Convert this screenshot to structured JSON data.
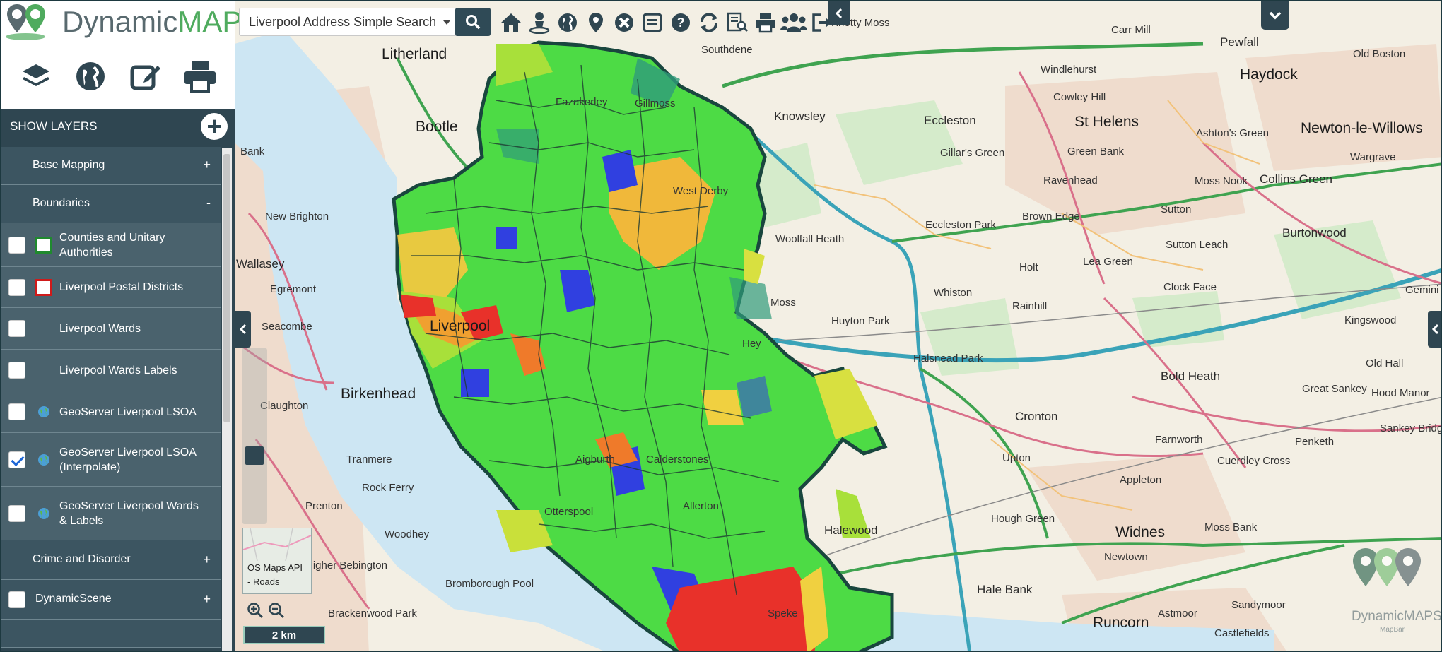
{
  "app": {
    "logo": {
      "part1": "Dynamic",
      "part2": "MAPS"
    },
    "accent_colors": {
      "panel": "#2f4651",
      "logo_green": "#4fab5e",
      "logo_grey": "#596a6f"
    }
  },
  "toolbar_main": {
    "icons": [
      "layers-icon",
      "globe-icon",
      "edit-icon",
      "print-icon"
    ]
  },
  "search": {
    "selected": "Liverpool Address Simple Search",
    "button_icon": "search-icon"
  },
  "top_icons": [
    "home-icon",
    "user-location-icon",
    "globe-icon",
    "map-pin-icon",
    "close-circle-icon",
    "window-icon",
    "help-icon",
    "refresh-icon",
    "report-icon",
    "print-icon",
    "users-icon",
    "sign-out-icon"
  ],
  "layers_panel": {
    "header": "SHOW LAYERS",
    "add_icon": "plus-circle-icon",
    "items": [
      {
        "type": "group",
        "label": "Base Mapping",
        "toggle": "+"
      },
      {
        "type": "group",
        "label": "Boundaries",
        "toggle": "-"
      },
      {
        "type": "layer",
        "label": "Counties and Unitary Authorities",
        "checked": false,
        "swatch": "#1f8a2e"
      },
      {
        "type": "layer",
        "label": "Liverpool Postal Districts",
        "checked": false,
        "swatch": "#d01a1a"
      },
      {
        "type": "layer",
        "label": "Liverpool Wards",
        "checked": false
      },
      {
        "type": "layer",
        "label": "Liverpool Wards Labels",
        "checked": false
      },
      {
        "type": "layer",
        "label": "GeoServer Liverpool LSOA",
        "checked": false,
        "icon": "globe-icon"
      },
      {
        "type": "layer",
        "label": "GeoServer Liverpool LSOA (Interpolate)",
        "checked": true,
        "icon": "globe-icon"
      },
      {
        "type": "layer",
        "label": "GeoServer Liverpool Wards & Labels",
        "checked": false,
        "icon": "globe-icon"
      },
      {
        "type": "group",
        "label": "Crime and Disorder",
        "toggle": "+"
      },
      {
        "type": "group",
        "label": "DynamicScene",
        "toggle": "+",
        "checkbox": true
      }
    ]
  },
  "map": {
    "places": [
      "Litherland",
      "Bootle",
      "Knowsley",
      "Southdene",
      "Carr Mill",
      "Pewfall",
      "Haydock",
      "Windlehurst",
      "Cowley Hill",
      "Old Boston",
      "Newton-le-Willows",
      "Ashton's Green",
      "Eccleston",
      "St Helens",
      "Gillar's Green",
      "Green Bank",
      "Moss Nook",
      "Collins Green",
      "Wargrave",
      "Ravenhead",
      "Brown Edge",
      "Sutton",
      "Burtonwood",
      "Woolfall Heath",
      "Eccleston Park",
      "Lea Green",
      "Sutton Leach",
      "Holt",
      "Whiston",
      "Clock Face",
      "Rainhill",
      "Gemini",
      "Huyton Park",
      "Kingswood",
      "Old Hall",
      "Halsnead Park",
      "Bold Heath",
      "Great Sankey",
      "Hood Manor",
      "Sankey Bridges",
      "Penketh",
      "Cronton",
      "Farnworth",
      "Cuerdley Cross",
      "Upton",
      "Appleton",
      "Hough Green",
      "Widnes",
      "Moss Bank",
      "Halewood",
      "Newtown",
      "Hale Bank",
      "Astmoor",
      "Sandymoor",
      "Runcorn",
      "Castlefields",
      "New Brighton",
      "Wallasey",
      "Egremont",
      "Seacombe",
      "Birkenhead",
      "Claughton",
      "Tranmere",
      "Rock Ferry",
      "Prenton",
      "Woodhey",
      "Higher Bebington",
      "Bromborough Pool",
      "Brackenwood Park",
      "Bank",
      "Liverpool",
      "Moss",
      "Knotty Moss",
      "Hey",
      "Fazakerley",
      "Gillmoss",
      "West Derby",
      "Allerton",
      "Aigburth",
      "Calderstones",
      "Otterspool",
      "Speke"
    ],
    "attribution": {
      "line1": "OS Maps API",
      "line2": "- Roads"
    },
    "scale": "2 km",
    "zoom_in_icon": "zoom-in-icon",
    "zoom_out_icon": "zoom-out-icon",
    "watermark": {
      "text": "DynamicMAPS",
      "sub": "MapBar"
    }
  }
}
